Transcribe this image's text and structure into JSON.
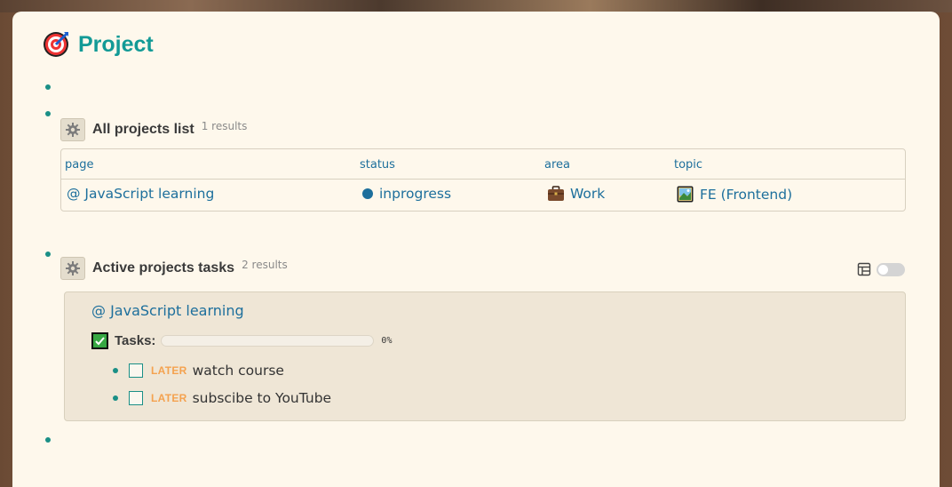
{
  "page": {
    "title": "Project",
    "title_icon": "target-icon"
  },
  "queries": [
    {
      "title": "All projects list",
      "count": "1 results",
      "columns": [
        "page",
        "status",
        "area",
        "topic"
      ],
      "rows": [
        {
          "page": "@ JavaScript learning",
          "status": "inprogress",
          "area": "Work",
          "area_icon": "briefcase-icon",
          "topic": "FE (Frontend)",
          "topic_icon": "framed-picture-icon"
        }
      ]
    },
    {
      "title": "Active projects tasks",
      "count": "2 results",
      "group": {
        "page": "@ JavaScript learning",
        "tasks_label": "Tasks:",
        "progress": 0,
        "progress_text": "0%",
        "items": [
          {
            "marker": "LATER",
            "text": "watch course"
          },
          {
            "marker": "LATER",
            "text": "subscibe to YouTube"
          }
        ]
      }
    }
  ],
  "colors": {
    "accent": "#129a96",
    "link": "#1d6f9c",
    "later": "#f4a24f",
    "page_bg": "#fef8ec",
    "panel_bg": "#efe6d6"
  }
}
